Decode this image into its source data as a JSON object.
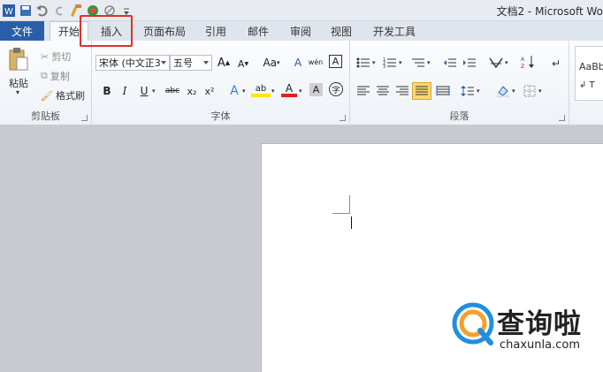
{
  "title_bar": {
    "window_title": "文档2 - Microsoft Wo",
    "quick_access": [
      "word-logo-icon",
      "save-icon",
      "undo-icon",
      "redo-icon",
      "format-painter-icon",
      "color-circle-icon",
      "no-icon",
      "customize-qat-icon"
    ]
  },
  "tabs": {
    "file": "文件",
    "items": [
      "开始",
      "插入",
      "页面布局",
      "引用",
      "邮件",
      "审阅",
      "视图",
      "开发工具"
    ],
    "active": "开始",
    "highlighted": "插入"
  },
  "ribbon": {
    "clipboard": {
      "label": "剪贴板",
      "paste": "粘贴",
      "cut": "剪切",
      "copy": "复制",
      "format_painter": "格式刷"
    },
    "font": {
      "label": "字体",
      "font_name": "宋体 (中文正3",
      "font_size": "五号",
      "grow": "A",
      "shrink": "A",
      "change_case": "Aa",
      "clear_format": "A",
      "phonetic": "wén",
      "border_char": "A",
      "bold": "B",
      "italic": "I",
      "underline": "U",
      "strike": "abc",
      "subscript": "x₂",
      "superscript": "x²",
      "text_effects": "A",
      "highlight": "ab",
      "font_color": "A",
      "char_shading": "A",
      "enclose": "字"
    },
    "paragraph": {
      "label": "段落"
    },
    "styles": {
      "preview": "AaBb",
      "sub": "↲ T"
    }
  },
  "watermark": {
    "text": "查询啦",
    "url": "chaxunla.com"
  },
  "colors": {
    "file_tab": "#2a5ea8",
    "highlight_box": "#e0302b",
    "watermark_blue": "#1f8fe0",
    "watermark_orange": "#f2a02b"
  }
}
